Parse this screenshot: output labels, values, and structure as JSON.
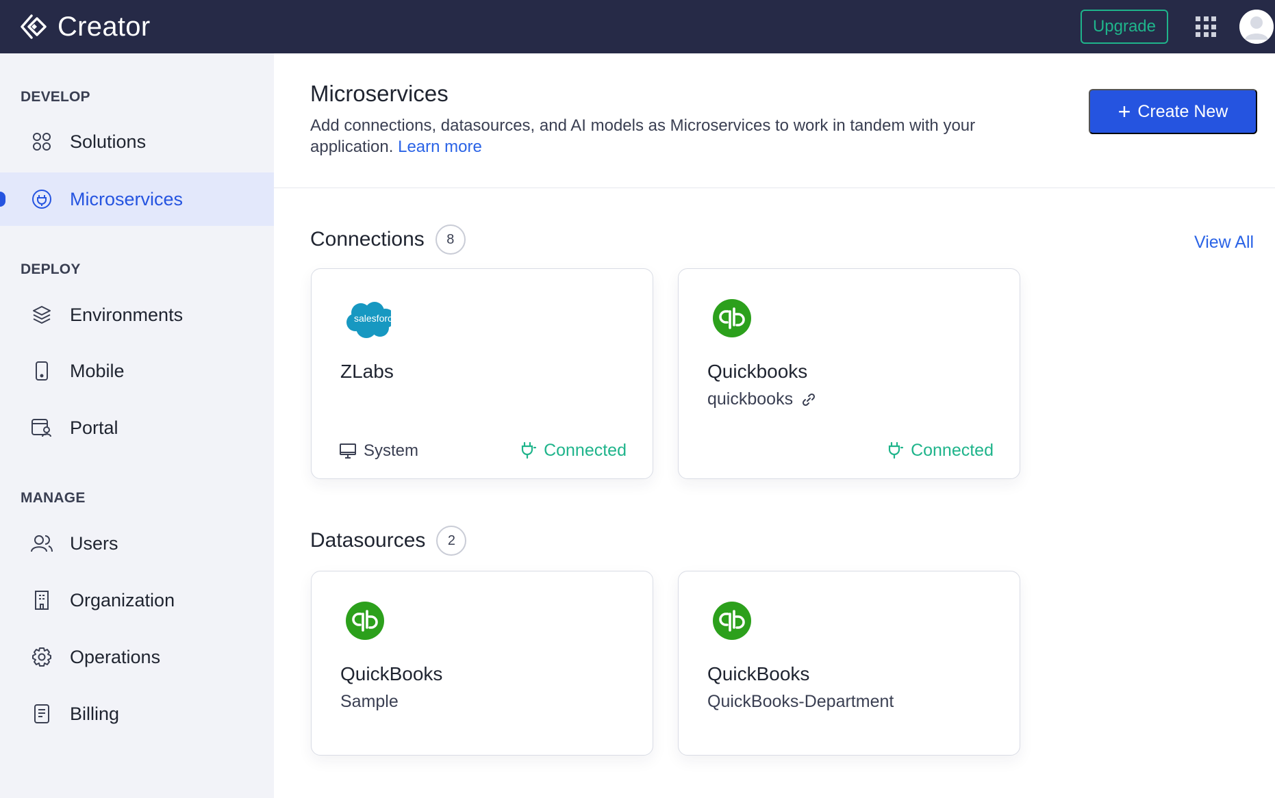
{
  "topbar": {
    "brand_name": "Creator",
    "upgrade_label": "Upgrade"
  },
  "sidebar": {
    "sections": [
      {
        "title": "DEVELOP"
      },
      {
        "title": "DEPLOY"
      },
      {
        "title": "MANAGE"
      }
    ],
    "items": [
      {
        "label": "Solutions",
        "icon": "solutions-icon"
      },
      {
        "label": "Microservices",
        "icon": "microservices-icon",
        "active": true
      },
      {
        "label": "Environments",
        "icon": "layers-icon"
      },
      {
        "label": "Mobile",
        "icon": "mobile-icon"
      },
      {
        "label": "Portal",
        "icon": "portal-icon"
      },
      {
        "label": "Users",
        "icon": "users-icon"
      },
      {
        "label": "Organization",
        "icon": "building-icon"
      },
      {
        "label": "Operations",
        "icon": "gear-icon"
      },
      {
        "label": "Billing",
        "icon": "receipt-icon"
      }
    ]
  },
  "main": {
    "title": "Microservices",
    "description": "Add connections, datasources, and AI models as Microservices to work in tandem with your application.",
    "learn_more": "Learn more",
    "create_new_label": "Create New",
    "view_all_label": "View All",
    "connections": {
      "title": "Connections",
      "count": "8",
      "cards": [
        {
          "name": "ZLabs",
          "logo": "salesforce",
          "logo_text": "salesforce",
          "type": "System",
          "status": "Connected"
        },
        {
          "name": "Quickbooks",
          "logo": "quickbooks",
          "subtitle": "quickbooks",
          "status": "Connected"
        }
      ]
    },
    "datasources": {
      "title": "Datasources",
      "count": "2",
      "cards": [
        {
          "name": "QuickBooks",
          "logo": "quickbooks",
          "subtitle": "Sample"
        },
        {
          "name": "QuickBooks",
          "logo": "quickbooks",
          "subtitle": "QuickBooks-Department"
        }
      ]
    }
  },
  "colors": {
    "topbar_bg": "#262a47",
    "accent_blue": "#2554e0",
    "link_blue": "#2a63e6",
    "connected_green": "#1fb48b",
    "quickbooks_green": "#2ca01c",
    "salesforce_blue": "#1798c1"
  }
}
